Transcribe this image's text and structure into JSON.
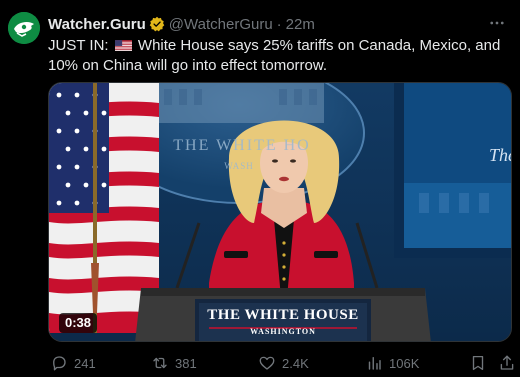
{
  "tweet": {
    "author_name": "Watcher.Guru",
    "handle": "@WatcherGuru",
    "separator": "·",
    "time": "22m",
    "text_prefix": "JUST IN:",
    "text_body": "White House says 25% tariffs on Canada, Mexico, and 10% on China will go into effect tomorrow.",
    "flag_icon": "us-flag-icon"
  },
  "media": {
    "seal_text": "THE WHITE HO",
    "seal_sub": "WASH",
    "right_partial_text": "The",
    "podium_title": "THE WHITE HOUSE",
    "podium_subtitle": "WASHINGTON",
    "duration": "0:38"
  },
  "actions": {
    "replies": "241",
    "reposts": "381",
    "likes": "2.4K",
    "views": "106K"
  },
  "colors": {
    "background": "#000000",
    "text": "#e7e9ea",
    "muted": "#71767b",
    "verified_gold": "#e2b719",
    "avatar_green": "#0e8c43"
  }
}
